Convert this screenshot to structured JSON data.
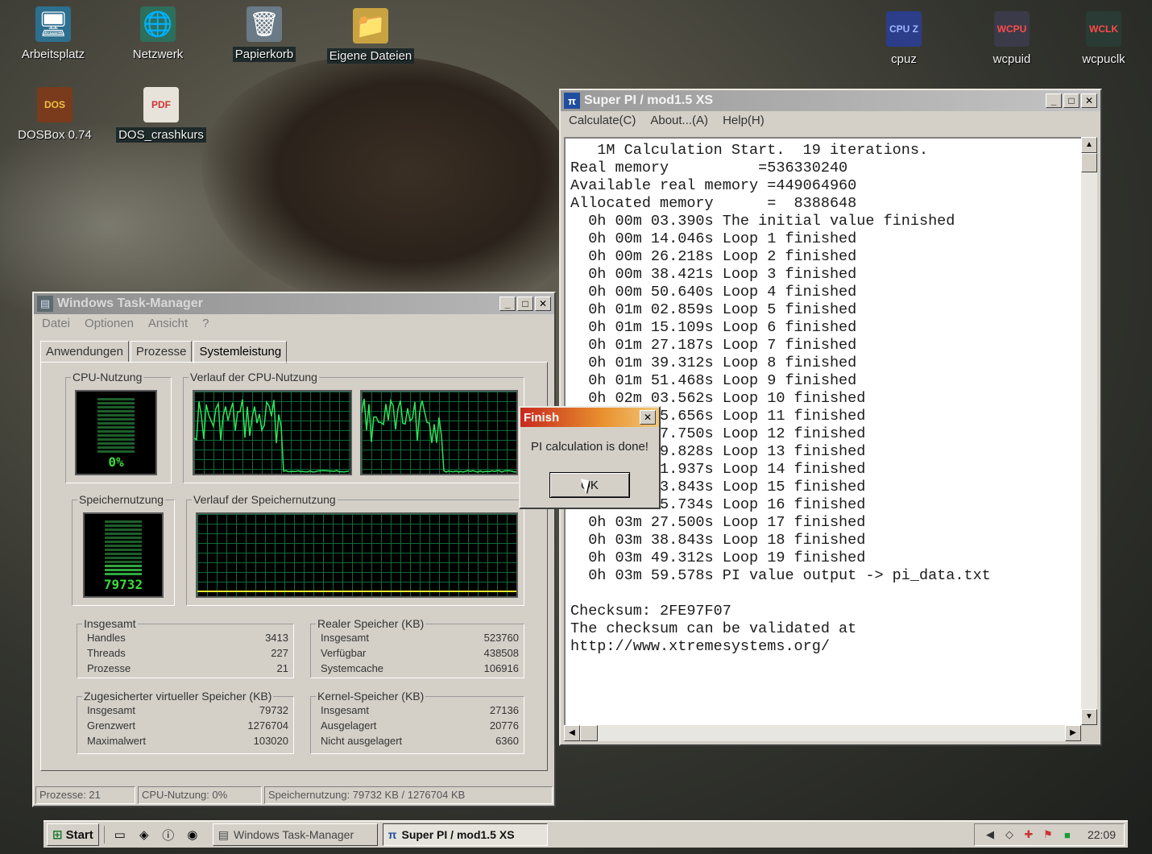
{
  "desktop": {
    "icons": [
      {
        "label": "Arbeitsplatz",
        "glyph": "🖥"
      },
      {
        "label": "Netzwerk",
        "glyph": "🌐"
      },
      {
        "label": "Papierkorb",
        "glyph": "🗑"
      },
      {
        "label": "Eigene Dateien",
        "glyph": "📁"
      },
      {
        "label": "DOSBox 0.74",
        "glyph": "▦"
      },
      {
        "label": "DOS_crashkurs",
        "glyph": "📄"
      },
      {
        "label": "cpuz",
        "glyph": "▣"
      },
      {
        "label": "wcpuid",
        "glyph": "▣"
      },
      {
        "label": "wcpuclk",
        "glyph": "▣"
      }
    ],
    "icon_badges": {
      "cpuz": "CPU Z",
      "wcpuid": "WCPU",
      "wcpuclk": "WCLK",
      "dosbox": "DOS",
      "pdf": "PDF"
    }
  },
  "taskmgr": {
    "title": "Windows Task-Manager",
    "menu": [
      "Datei",
      "Optionen",
      "Ansicht",
      "?"
    ],
    "tabs": [
      "Anwendungen",
      "Prozesse",
      "Systemleistung"
    ],
    "selected_tab": "Systemleistung",
    "cpu_usage_label": "CPU-Nutzung",
    "cpu_history_label": "Verlauf der CPU-Nutzung",
    "mem_usage_label": "Speichernutzung",
    "mem_history_label": "Verlauf der Speichernutzung",
    "cpu_meter_value": "0%",
    "mem_meter_value": "79732",
    "totals": {
      "label": "Insgesamt",
      "rows": [
        {
          "name": "Handles",
          "value": "3413"
        },
        {
          "name": "Threads",
          "value": "227"
        },
        {
          "name": "Prozesse",
          "value": "21"
        }
      ]
    },
    "physical": {
      "label": "Realer Speicher (KB)",
      "rows": [
        {
          "name": "Insgesamt",
          "value": "523760"
        },
        {
          "name": "Verfügbar",
          "value": "438508"
        },
        {
          "name": "Systemcache",
          "value": "106916"
        }
      ]
    },
    "commit": {
      "label": "Zugesicherter virtueller Speicher (KB)",
      "rows": [
        {
          "name": "Insgesamt",
          "value": "79732"
        },
        {
          "name": "Grenzwert",
          "value": "1276704"
        },
        {
          "name": "Maximalwert",
          "value": "103020"
        }
      ]
    },
    "kernel": {
      "label": "Kernel-Speicher (KB)",
      "rows": [
        {
          "name": "Insgesamt",
          "value": "27136"
        },
        {
          "name": "Ausgelagert",
          "value": "20776"
        },
        {
          "name": "Nicht ausgelagert",
          "value": "6360"
        }
      ]
    },
    "status": {
      "processes": "Prozesse: 21",
      "cpu": "CPU-Nutzung: 0%",
      "memory": "Speichernutzung: 79732 KB / 1276704 KB"
    }
  },
  "superpi": {
    "title": "Super PI / mod1.5 XS",
    "menu": [
      "Calculate(C)",
      "About...(A)",
      "Help(H)"
    ],
    "output_lines": [
      "   1M Calculation Start.  19 iterations.",
      "Real memory          =536330240",
      "Available real memory =449064960",
      "Allocated memory      =  8388648",
      "  0h 00m 03.390s The initial value finished",
      "  0h 00m 14.046s Loop 1 finished",
      "  0h 00m 26.218s Loop 2 finished",
      "  0h 00m 38.421s Loop 3 finished",
      "  0h 00m 50.640s Loop 4 finished",
      "  0h 01m 02.859s Loop 5 finished",
      "  0h 01m 15.109s Loop 6 finished",
      "  0h 01m 27.187s Loop 7 finished",
      "  0h 01m 39.312s Loop 8 finished",
      "  0h 01m 51.468s Loop 9 finished",
      "  0h 02m 03.562s Loop 10 finished",
      "  0h 02m 15.656s Loop 11 finished",
      "  0h 02m 27.750s Loop 12 finished",
      "  0h 02m 39.828s Loop 13 finished",
      "  0h 02m 51.937s Loop 14 finished",
      "  0h 03m 03.843s Loop 15 finished",
      "  0h 03m 15.734s Loop 16 finished",
      "  0h 03m 27.500s Loop 17 finished",
      "  0h 03m 38.843s Loop 18 finished",
      "  0h 03m 49.312s Loop 19 finished",
      "  0h 03m 59.578s PI value output -> pi_data.txt",
      "",
      "Checksum: 2FE97F07",
      "The checksum can be validated at",
      "http://www.xtremesystems.org/"
    ]
  },
  "dialog": {
    "title": "Finish",
    "message": "PI calculation is done!",
    "ok_label": "OK"
  },
  "taskbar": {
    "start_label": "Start",
    "tasks": [
      {
        "label": "Windows Task-Manager",
        "pressed": false
      },
      {
        "label": "Super PI / mod1.5 XS",
        "pressed": true
      }
    ],
    "clock": "22:09"
  },
  "glyphs": {
    "minimize": "_",
    "maximize": "□",
    "close": "✕",
    "scroll_up": "▲",
    "scroll_down": "▼",
    "scroll_left": "◀",
    "scroll_right": "▶"
  },
  "colors": {
    "graph_line": "#2fe35a",
    "graph_grid": "#0c6b3a",
    "mem_line": "#e5e52a",
    "dialog_title": "#c8281e"
  }
}
